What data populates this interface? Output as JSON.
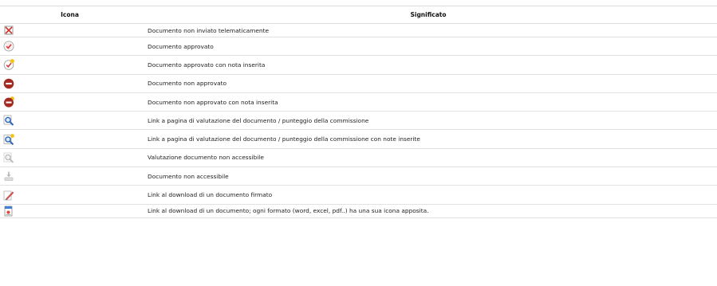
{
  "table": {
    "headers": [
      "Icona",
      "Significato"
    ],
    "rows": [
      {
        "icon": "mail-crossed-icon",
        "text": "Documento non inviato telematicamente"
      },
      {
        "icon": "check-approved-icon",
        "text": "Documento approvato"
      },
      {
        "icon": "check-approved-note-icon",
        "text": "Documento approvato con nota inserita"
      },
      {
        "icon": "not-approved-icon",
        "text": "Documento non approvato"
      },
      {
        "icon": "not-approved-note-icon",
        "text": "Documento non approvato con nota inserita"
      },
      {
        "icon": "magnifier-icon",
        "text": "Link a pagina di valutazione del documento / punteggio della commissione"
      },
      {
        "icon": "magnifier-note-icon",
        "text": "Link a pagina di valutazione del documento / punteggio della commissione con note inserite"
      },
      {
        "icon": "magnifier-disabled-icon",
        "text": "Valutazione documento non accessibile"
      },
      {
        "icon": "download-disabled-icon",
        "text": "Documento non accessibile"
      },
      {
        "icon": "pencil-signed-icon",
        "text": "Link al download di un documento firmato"
      },
      {
        "icon": "document-file-icon",
        "text": "Link al download di un documento; ogni formato (word, excel, pdf..) ha una sua icona apposita."
      }
    ]
  },
  "colors": {
    "approved": "#cf3b3b",
    "not_approved": "#a32a22",
    "note": "#f4c21a",
    "magnifier": "#2a63b5"
  }
}
